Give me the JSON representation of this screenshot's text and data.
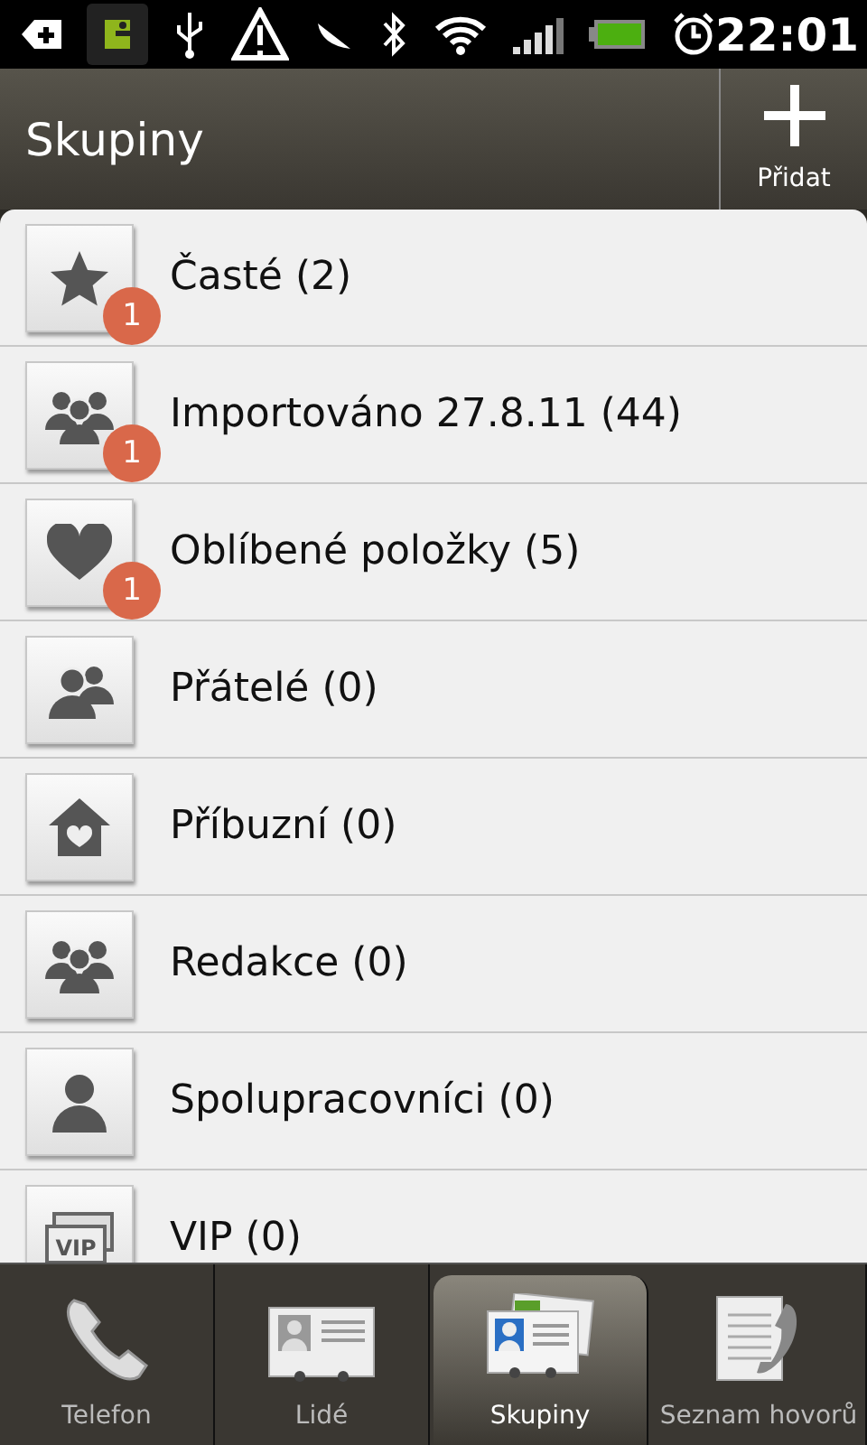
{
  "status_bar": {
    "time": "22:01"
  },
  "header": {
    "title": "Skupiny",
    "add_label": "Přidat"
  },
  "groups": [
    {
      "name": "Časté (2)",
      "kind": "star",
      "badge": "1"
    },
    {
      "name": "Importováno 27.8.11 (44)",
      "kind": "group",
      "badge": "1"
    },
    {
      "name": "Oblíbené položky (5)",
      "kind": "heart",
      "badge": "1"
    },
    {
      "name": "Přátelé (0)",
      "kind": "pair"
    },
    {
      "name": "Příbuzní (0)",
      "kind": "house"
    },
    {
      "name": "Redakce (0)",
      "kind": "group"
    },
    {
      "name": "Spolupracovníci (0)",
      "kind": "person"
    },
    {
      "name": "VIP (0)",
      "kind": "vip",
      "icon_label": "VIP"
    }
  ],
  "tabs": [
    {
      "label": "Telefon",
      "kind": "phone",
      "selected": false
    },
    {
      "label": "Lidé",
      "kind": "card",
      "selected": false
    },
    {
      "label": "Skupiny",
      "kind": "cards",
      "selected": true
    },
    {
      "label": "Seznam hovorů",
      "kind": "log",
      "selected": false
    }
  ]
}
